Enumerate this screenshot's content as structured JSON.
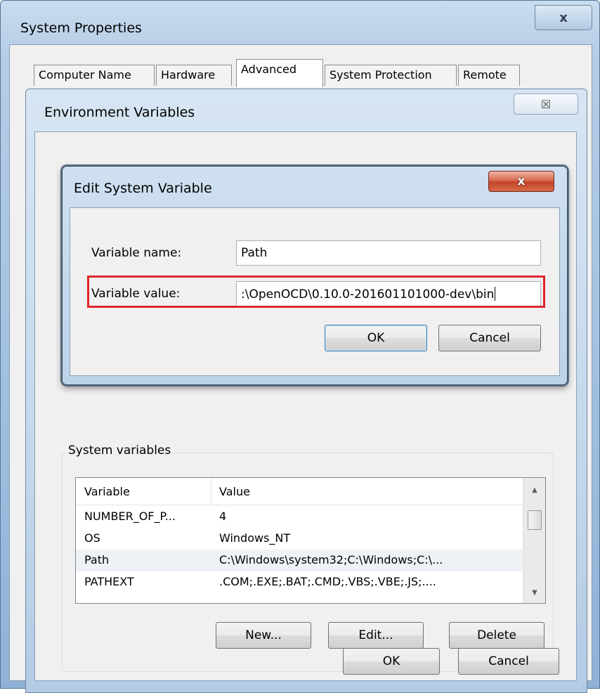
{
  "system_properties": {
    "title": "System Properties",
    "close_glyph": "x",
    "tabs": [
      {
        "label": "Computer Name",
        "active": false
      },
      {
        "label": "Hardware",
        "active": false
      },
      {
        "label": "Advanced",
        "active": true
      },
      {
        "label": "System Protection",
        "active": false
      },
      {
        "label": "Remote",
        "active": false
      }
    ]
  },
  "environment_variables": {
    "title": "Environment Variables",
    "close_glyph": "☒",
    "system_variables": {
      "legend": "System variables",
      "columns": [
        "Variable",
        "Value"
      ],
      "rows": [
        {
          "variable": "NUMBER_OF_P...",
          "value": "4",
          "selected": false
        },
        {
          "variable": "OS",
          "value": "Windows_NT",
          "selected": false
        },
        {
          "variable": "Path",
          "value": "C:\\Windows\\system32;C:\\Windows;C:\\...",
          "selected": true
        },
        {
          "variable": "PATHEXT",
          "value": ".COM;.EXE;.BAT;.CMD;.VBS;.VBE;.JS;....",
          "selected": false
        }
      ],
      "buttons": {
        "new": "New...",
        "edit": "Edit...",
        "delete": "Delete"
      }
    },
    "buttons": {
      "ok": "OK",
      "cancel": "Cancel"
    }
  },
  "edit_system_variable": {
    "title": "Edit System Variable",
    "close_glyph": "x",
    "variable_name_label": "Variable name:",
    "variable_name_value": "Path",
    "variable_value_label": "Variable value:",
    "variable_value_value": ":\\OpenOCD\\0.10.0-201601101000-dev\\bin",
    "buttons": {
      "ok": "OK",
      "cancel": "Cancel"
    }
  },
  "colors": {
    "highlight": "#e0262d",
    "aero_frame": "#b6cde6",
    "close_button_red": "#c2452a"
  }
}
